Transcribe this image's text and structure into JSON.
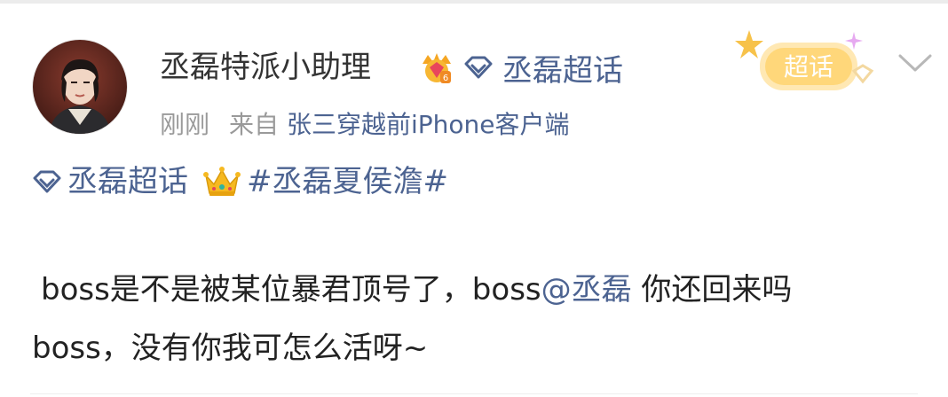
{
  "post": {
    "username": "丞磊特派小助理",
    "member_badge_icon": "vip-crown-badge-icon",
    "topic_link": "丞磊超话",
    "time": "刚刚",
    "source_prefix": "来自",
    "source": "张三穿越前iPhone客户端",
    "stamp_label": "超话",
    "topic_tag": "丞磊超话",
    "hashtag": "#丞磊夏侯澹#",
    "body_part1": "boss是不是被某位暴君顶号了，boss",
    "mention": "@丞磊",
    "body_part2": " 你还回来吗",
    "body_line2": "boss，没有你我可怎么活呀~"
  },
  "colors": {
    "link": "#4c6391",
    "meta": "#9a9a9a",
    "text": "#222222",
    "stamp": "#f7c24a"
  }
}
